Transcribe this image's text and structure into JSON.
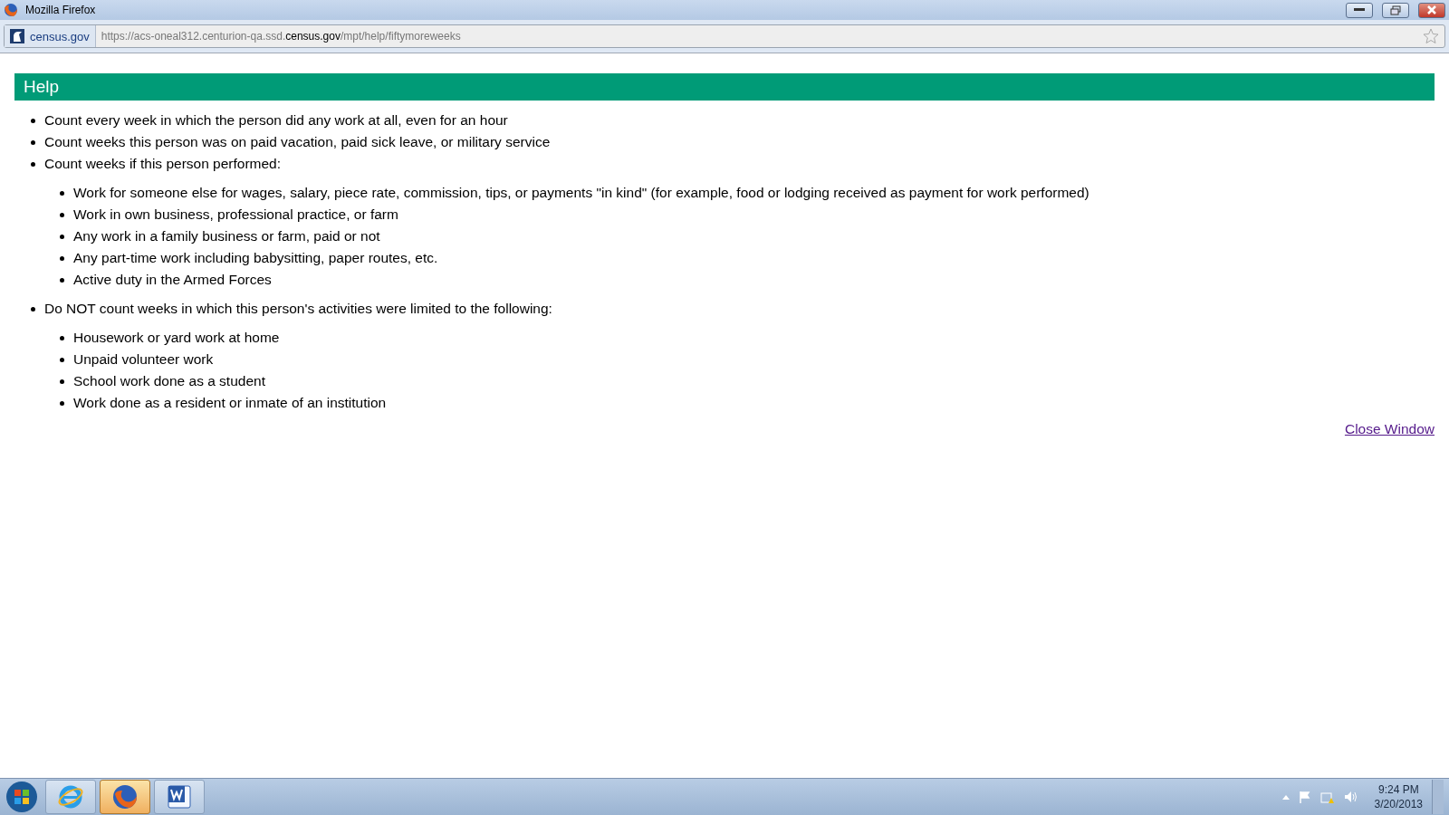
{
  "window": {
    "title": "Mozilla Firefox"
  },
  "address_bar": {
    "site": "census.gov",
    "url": "https://acs-oneal312.centurion-qa.ssd.**census.gov**/mpt/help/fiftymoreweeks"
  },
  "page": {
    "heading": "Help",
    "items": [
      {
        "text": "Count every week in which the person did any work at all, even for an hour"
      },
      {
        "text": "Count weeks this person was on paid vacation, paid sick leave, or military service"
      },
      {
        "text": "Count weeks if this person performed:",
        "children": [
          {
            "text": "Work for someone else for wages, salary, piece rate, commission, tips, or payments \"in kind\" (for example, food or lodging received as payment for work performed)"
          },
          {
            "text": "Work in own business, professional practice, or farm"
          },
          {
            "text": "Any work in a family business or farm, paid or not"
          },
          {
            "text": "Any part-time work including babysitting, paper routes, etc."
          },
          {
            "text": "Active duty in the Armed Forces"
          }
        ]
      },
      {
        "text": "Do NOT count weeks in which this person's activities were limited to the following:",
        "children": [
          {
            "text": "Housework or yard work at home"
          },
          {
            "text": "Unpaid volunteer work"
          },
          {
            "text": "School work done as a student"
          },
          {
            "text": "Work done as a resident or inmate of an institution"
          }
        ]
      }
    ],
    "close_link": "Close Window"
  },
  "taskbar": {
    "apps": [
      {
        "kind": "ie",
        "selected": false
      },
      {
        "kind": "firefox",
        "selected": true
      },
      {
        "kind": "word",
        "selected": false
      }
    ],
    "time": "9:24 PM",
    "date": "3/20/2013"
  }
}
